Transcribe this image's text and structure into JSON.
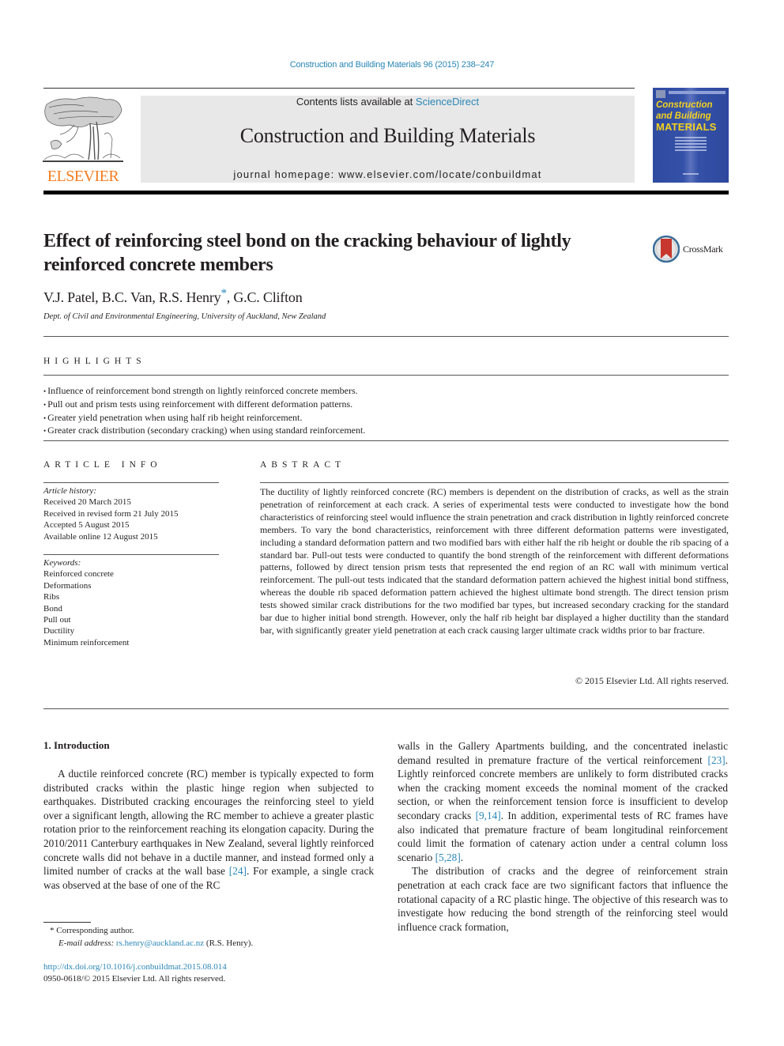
{
  "header": {
    "journal_reference": "Construction and Building Materials 96 (2015) 238–247",
    "publisher_wordmark": "ELSEVIER",
    "contents_prefix": "Contents lists available at ",
    "contents_link": "ScienceDirect",
    "journal_title": "Construction and Building Materials",
    "homepage_label": "journal homepage: www.elsevier.com/locate/conbuildmat",
    "cover": {
      "line1": "Construction",
      "line2": "and Building",
      "line3": "MATERIALS"
    },
    "colors": {
      "link": "#2a86b6",
      "elsevier_orange": "#f47d20",
      "cover_blue": "#3451a8",
      "cover_yellow": "#f5d21e",
      "masthead_gray": "#e8e8e8"
    }
  },
  "article": {
    "title": "Effect of reinforcing steel bond on the cracking behaviour of lightly reinforced concrete members",
    "crossmark_label": "CrossMark",
    "authors_before_star": "V.J. Patel, B.C. Van, R.S. Henry",
    "author_star": "*",
    "authors_after_star": ", G.C. Clifton",
    "affiliation": "Dept. of Civil and Environmental Engineering, University of Auckland, New Zealand"
  },
  "highlights": {
    "label": "HIGHLIGHTS",
    "items": [
      "Influence of reinforcement bond strength on lightly reinforced concrete members.",
      "Pull out and prism tests using reinforcement with different deformation patterns.",
      "Greater yield penetration when using half rib height reinforcement.",
      "Greater crack distribution (secondary cracking) when using standard reinforcement."
    ]
  },
  "article_info": {
    "label": "ARTICLE INFO",
    "history_label": "Article history:",
    "history": [
      "Received 20 March 2015",
      "Received in revised form 21 July 2015",
      "Accepted 5 August 2015",
      "Available online 12 August 2015"
    ],
    "keywords_label": "Keywords:",
    "keywords": [
      "Reinforced concrete",
      "Deformations",
      "Ribs",
      "Bond",
      "Pull out",
      "Ductility",
      "Minimum reinforcement"
    ]
  },
  "abstract": {
    "label": "ABSTRACT",
    "text": "The ductility of lightly reinforced concrete (RC) members is dependent on the distribution of cracks, as well as the strain penetration of reinforcement at each crack. A series of experimental tests were con­ducted to investigate how the bond characteristics of reinforcing steel would influence the strain pene­tration and crack distribution in lightly reinforced concrete members. To vary the bond characteristics, reinforcement with three different deformation patterns were investigated, including a standard defor­mation pattern and two modified bars with either half the rib height or double the rib spacing of a stan­dard bar. Pull-out tests were conducted to quantify the bond strength of the reinforcement with different deformations patterns, followed by direct tension prism tests that represented the end region of an RC wall with minimum vertical reinforcement. The pull-out tests indicated that the standard deformation pattern achieved the highest initial bond stiffness, whereas the double rib spaced deformation pattern achieved the highest ultimate bond strength. The direct tension prism tests showed similar crack distri­butions for the two modified bar types, but increased secondary cracking for the standard bar due to higher initial bond strength. However, only the half rib height bar displayed a higher ductility than the standard bar, with significantly greater yield penetration at each crack causing larger ultimate crack widths prior to bar fracture.",
    "copyright": "© 2015 Elsevier Ltd. All rights reserved."
  },
  "introduction": {
    "heading": "1. Introduction",
    "left_column": {
      "p1_a": "A ductile reinforced concrete (RC) member is typically expected to form distributed cracks within the plastic hinge region when subjected to earthquakes. Distributed cracking encourages the reinforcing steel to yield over a significant length, allowing the RC member to achieve a greater plastic rotation prior to the rein­forcement reaching its elongation capacity. During the 2010/2011 Canterbury earthquakes in New Zealand, several lightly reinforced concrete walls did not behave in a ductile manner, and instead formed only a limited number of cracks at the wall base ",
      "ref1": "[24]",
      "p1_b": ". For example, a single crack was observed at the base of one of the RC"
    },
    "right_column": {
      "p1_a": "walls in the Gallery Apartments building, and the concentrated inelastic demand resulted in premature fracture of the vertical reinforcement ",
      "ref1": "[23]",
      "p1_b": ". Lightly reinforced concrete members are unli­kely to form distributed cracks when the cracking moment exceeds the nominal moment of the cracked section, or when the reinforce­ment tension force is insufficient to develop secondary cracks ",
      "ref2": "[9,14]",
      "p1_c": ". In addition, experimental tests of RC frames have also indi­cated that premature fracture of beam longitudinal reinforcement could limit the formation of catenary action under a central col­umn loss scenario ",
      "ref3": "[5,28]",
      "p1_d": ".",
      "p2": "The distribution of cracks and the degree of reinforcement strain penetration at each crack face are two significant factors that influence the rotational capacity of a RC plastic hinge. The objective of this research was to investigate how reducing the bond strength of the reinforcing steel would influence crack formation,"
    }
  },
  "footnotes": {
    "star": "*",
    "corresponding": "Corresponding author.",
    "email_label": "E-mail address:",
    "email": "rs.henry@auckland.ac.nz",
    "email_suffix": " (R.S. Henry).",
    "doi": "http://dx.doi.org/10.1016/j.conbuildmat.2015.08.014",
    "issn_line": "0950-0618/© 2015 Elsevier Ltd. All rights reserved."
  }
}
